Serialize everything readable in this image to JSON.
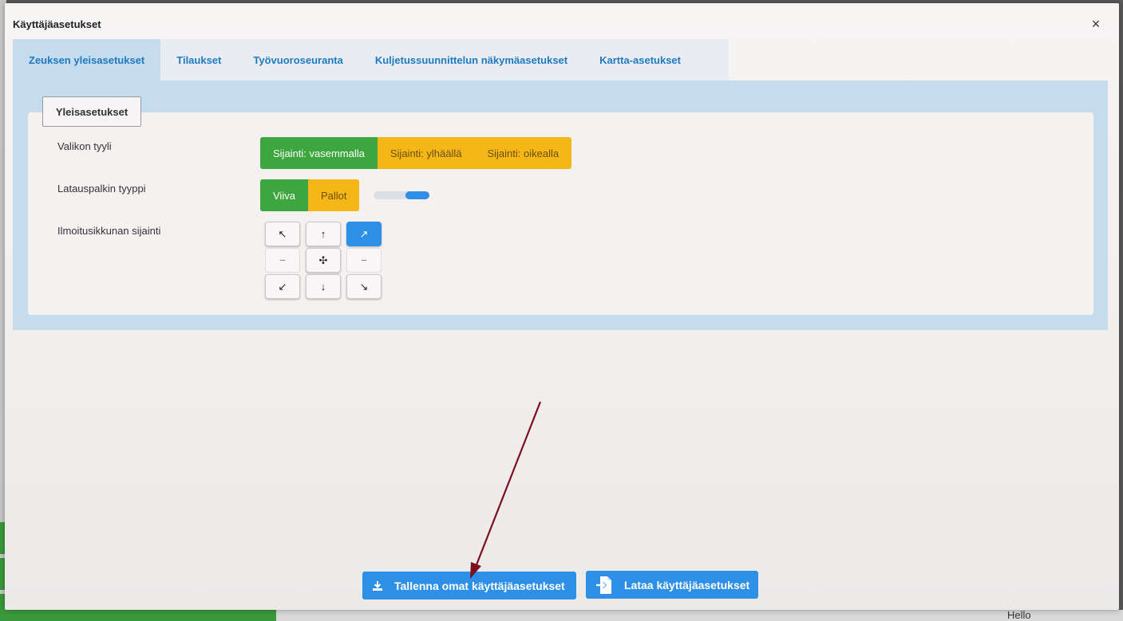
{
  "dialog": {
    "title": "Käyttäjäasetukset",
    "close_symbol": "×"
  },
  "tabs": [
    {
      "label": "Zeuksen yleisasetukset",
      "active": true
    },
    {
      "label": "Tilaukset",
      "active": false
    },
    {
      "label": "Työvuoroseuranta",
      "active": false
    },
    {
      "label": "Kuljetussuunnittelun näkymäasetukset",
      "active": false
    },
    {
      "label": "Kartta-asetukset",
      "active": false
    }
  ],
  "section": {
    "button_label": "Yleisasetukset"
  },
  "menu_style": {
    "label": "Valikon tyyli",
    "options": [
      "Sijainti: vasemmalla",
      "Sijainti: ylhäällä",
      "Sijainti: oikealla"
    ],
    "selected": "Sijainti: vasemmalla"
  },
  "loading_bar": {
    "label": "Latauspalkin tyyppi",
    "options": [
      "Viiva",
      "Pallot"
    ],
    "selected": "Viiva"
  },
  "notification_position": {
    "label": "Ilmoitusikkunan sijainti",
    "grid": [
      {
        "symbol": "↖",
        "icon": "arrow-up-left-icon"
      },
      {
        "symbol": "↑",
        "icon": "arrow-up-icon"
      },
      {
        "symbol": "↗",
        "icon": "arrow-up-right-icon"
      },
      {
        "symbol": "−",
        "icon": "dash-left-icon"
      },
      {
        "symbol": "✣",
        "icon": "move-center-icon"
      },
      {
        "symbol": "−",
        "icon": "dash-right-icon"
      },
      {
        "symbol": "↙",
        "icon": "arrow-down-left-icon"
      },
      {
        "symbol": "↓",
        "icon": "arrow-down-icon"
      },
      {
        "symbol": "↘",
        "icon": "arrow-down-right-icon"
      }
    ],
    "selected": "arrow-up-right-icon"
  },
  "actions": {
    "save_label": "Tallenna omat käyttäjäasetukset",
    "load_label": "Lataa käyttäjäasetukset"
  },
  "background": {
    "bottom_text": "Hello"
  },
  "colors": {
    "accent_blue": "#2e8fe6",
    "green": "#3ea63e",
    "yellow": "#f5b718",
    "tab_panel": "#c5dcef",
    "annotation_arrow": "#7a0f1e"
  }
}
